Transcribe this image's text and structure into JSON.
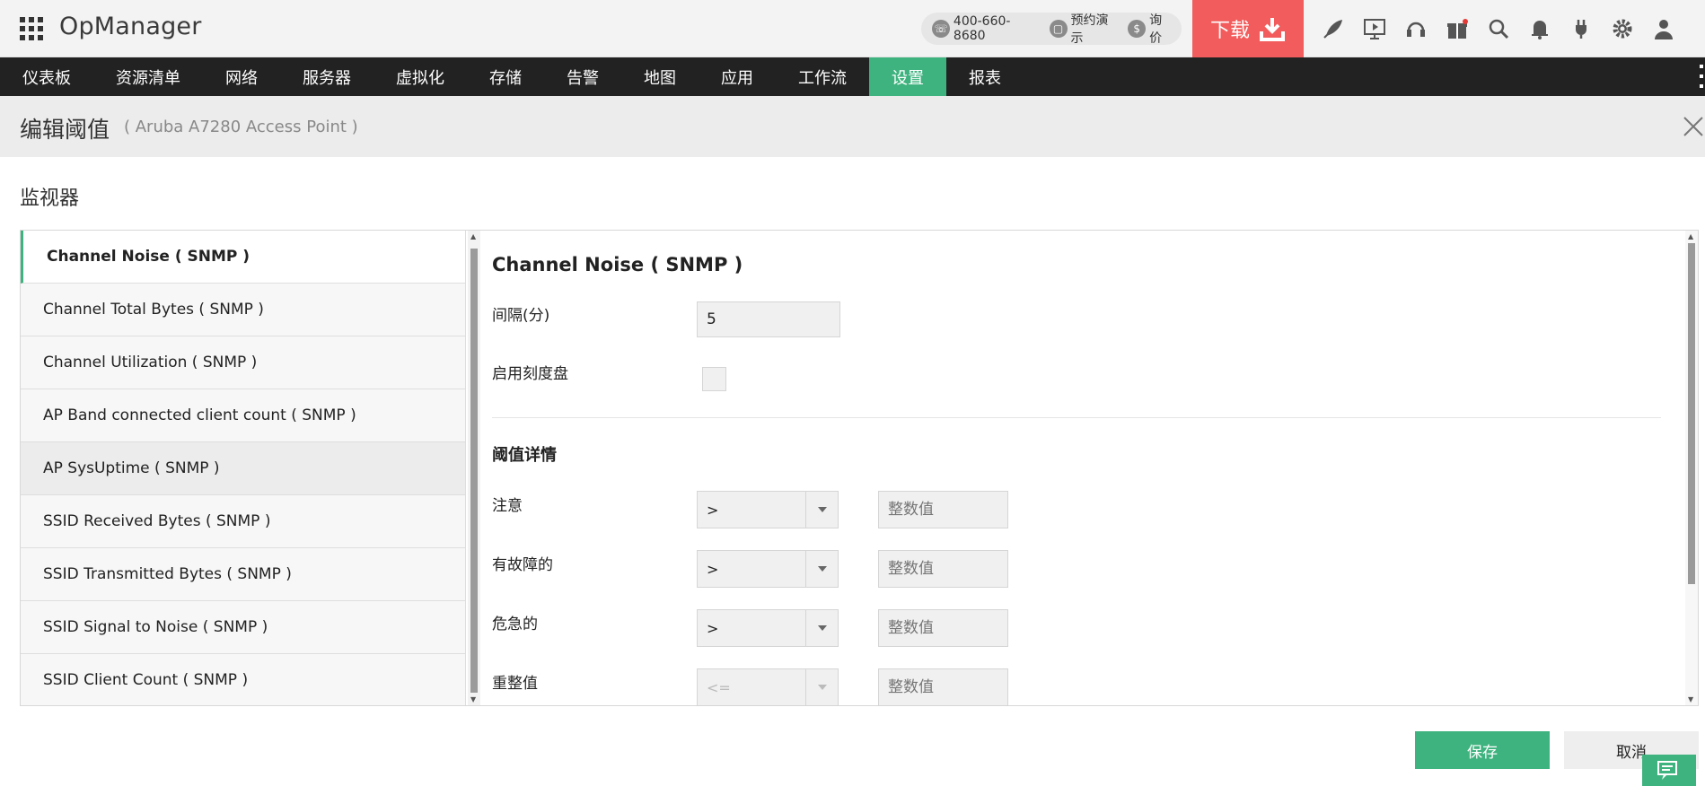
{
  "app": {
    "brand": "OpManager"
  },
  "header": {
    "phone": "400-660-8680",
    "demo": "预约演示",
    "quote": "询价",
    "download": "下载",
    "accent": "#f25c5c"
  },
  "nav": {
    "items": [
      {
        "label": "仪表板"
      },
      {
        "label": "资源清单"
      },
      {
        "label": "网络"
      },
      {
        "label": "服务器"
      },
      {
        "label": "虚拟化"
      },
      {
        "label": "存储"
      },
      {
        "label": "告警"
      },
      {
        "label": "地图"
      },
      {
        "label": "应用"
      },
      {
        "label": "工作流"
      },
      {
        "label": "设置"
      },
      {
        "label": "报表"
      }
    ],
    "active_index": 10,
    "active_color": "#3fb37f"
  },
  "page": {
    "title": "编辑阈值",
    "subtitle": "( Aruba A7280 Access Point )",
    "section_label": "监视器"
  },
  "monitors": {
    "items": [
      {
        "label": "Channel Noise ( SNMP )"
      },
      {
        "label": "Channel Total Bytes ( SNMP )"
      },
      {
        "label": "Channel Utilization ( SNMP )"
      },
      {
        "label": "AP Band connected client count ( SNMP )"
      },
      {
        "label": "AP SysUptime ( SNMP )"
      },
      {
        "label": "SSID Received Bytes ( SNMP )"
      },
      {
        "label": "SSID Transmitted Bytes ( SNMP )"
      },
      {
        "label": "SSID Signal to Noise ( SNMP )"
      },
      {
        "label": "SSID Client Count ( SNMP )"
      }
    ],
    "selected_index": 0,
    "hover_index": 4
  },
  "detail": {
    "title": "Channel Noise ( SNMP )",
    "interval_label": "间隔(分)",
    "interval_value": "5",
    "enable_dial_label": "启用刻度盘",
    "threshold_heading": "阈值详情",
    "rows": [
      {
        "label": "注意",
        "operator": ">",
        "placeholder": "整数值"
      },
      {
        "label": "有故障的",
        "operator": ">",
        "placeholder": "整数值"
      },
      {
        "label": "危急的",
        "operator": ">",
        "placeholder": "整数值"
      },
      {
        "label": "重整值",
        "operator": "<=",
        "placeholder": "整数值"
      }
    ]
  },
  "actions": {
    "save": "保存",
    "cancel": "取消"
  }
}
